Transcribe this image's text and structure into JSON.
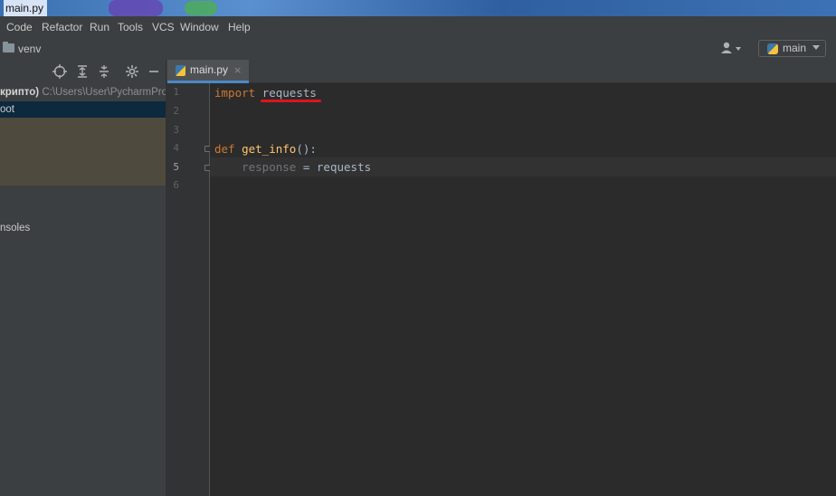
{
  "window": {
    "title": "main.py"
  },
  "menu": [
    "Code",
    "Refactor",
    "Run",
    "Tools",
    "VCS",
    "Window",
    "Help"
  ],
  "navbar": {
    "breadcrumb": "venv",
    "branch": "main"
  },
  "project": {
    "root_name": "крипто)",
    "root_path": "C:\\Users\\User\\PycharmProje",
    "selected_item": "oot",
    "consoles_item": "nsoles"
  },
  "editor": {
    "tab": {
      "label": "main.py",
      "close": "×"
    },
    "line_numbers": [
      "1",
      "2",
      "3",
      "4",
      "5",
      "6"
    ],
    "active_line": 5,
    "lines": [
      {
        "kw": "import",
        "rest": "requests"
      },
      {},
      {},
      {
        "kw": "def",
        "fn": "get_info",
        "punct": "():"
      },
      {
        "unused": "response",
        "rest": "= requests"
      },
      {}
    ]
  },
  "colors": {
    "editor_bg": "#2b2b2b",
    "keyword": "#cc7832",
    "function": "#ffc66d",
    "identifier": "#a9b7c6",
    "annotation": "#e0141c"
  },
  "icons": [
    "folder-icon",
    "user-icon",
    "python-icon",
    "locate-icon",
    "expand-all-icon",
    "collapse-all-icon",
    "gear-icon",
    "minimize-icon"
  ]
}
